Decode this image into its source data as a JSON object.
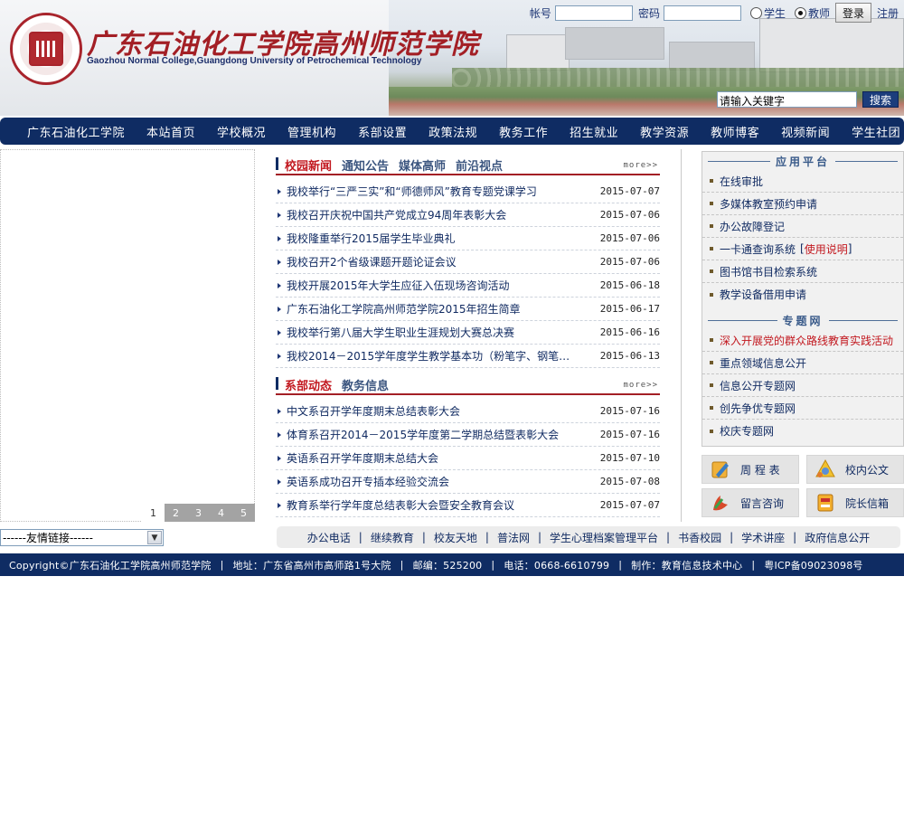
{
  "header": {
    "school_name_cn": "广东石油化工学院高州师范学院",
    "school_name_en": "Gaozhou Normal College,Guangdong University of Petrochemical Technology",
    "login": {
      "account_label": "帐号",
      "password_label": "密码",
      "account_value": "",
      "password_value": "",
      "roles": [
        {
          "label": "学生",
          "selected": false
        },
        {
          "label": "教师",
          "selected": true
        }
      ],
      "login_button": "登录",
      "register_link": "注册"
    },
    "search": {
      "input_value": "请输入关键字",
      "button": "搜索"
    }
  },
  "nav": {
    "items": [
      "广东石油化工学院",
      "本站首页",
      "学校概况",
      "管理机构",
      "系部设置",
      "政策法规",
      "教务工作",
      "招生就业",
      "教学资源",
      "教师博客",
      "视频新闻",
      "学生社团"
    ]
  },
  "slideshow": {
    "pages": [
      "1",
      "2",
      "3",
      "4",
      "5"
    ],
    "active_page": "1"
  },
  "friend_links": {
    "selected": "------友情链接------"
  },
  "news_block": {
    "tabs": [
      "校园新闻",
      "通知公告",
      "媒体高师",
      "前沿视点"
    ],
    "more": "more>>",
    "items": [
      {
        "title": "我校举行“三严三实”和“师德师风”教育专题党课学习",
        "date": "2015-07-07"
      },
      {
        "title": "我校召开庆祝中国共产党成立94周年表彰大会",
        "date": "2015-07-06"
      },
      {
        "title": "我校隆重举行2015届学生毕业典礼",
        "date": "2015-07-06"
      },
      {
        "title": "我校召开2个省级课题开题论证会议",
        "date": "2015-07-06"
      },
      {
        "title": "我校开展2015年大学生应征入伍现场咨询活动",
        "date": "2015-06-18"
      },
      {
        "title": "广东石油化工学院高州师范学院2015年招生简章",
        "date": "2015-06-17"
      },
      {
        "title": "我校举行第八届大学生职业生涯规划大赛总决赛",
        "date": "2015-06-16"
      },
      {
        "title": "我校2014－2015学年度学生教学基本功（粉笔字、钢笔…",
        "date": "2015-06-13"
      }
    ]
  },
  "dept_block": {
    "tabs": [
      "系部动态",
      "教务信息"
    ],
    "more": "more>>",
    "items": [
      {
        "title": "中文系召开学年度期末总结表彰大会",
        "date": "2015-07-16"
      },
      {
        "title": "体育系召开2014－2015学年度第二学期总结暨表彰大会",
        "date": "2015-07-16"
      },
      {
        "title": "英语系召开学年度期末总结大会",
        "date": "2015-07-10"
      },
      {
        "title": "英语系成功召开专插本经验交流会",
        "date": "2015-07-08"
      },
      {
        "title": "教育系举行学年度总结表彰大会暨安全教育会议",
        "date": "2015-07-07"
      }
    ]
  },
  "platform": {
    "title": "应用平台",
    "items": [
      {
        "label": "在线审批"
      },
      {
        "label": "多媒体教室预约申请"
      },
      {
        "label": "办公故障登记"
      },
      {
        "label": "一卡通查询系统",
        "extra_prefix": "[",
        "extra": "使用说明",
        "extra_suffix": "]"
      },
      {
        "label": "图书馆书目检索系统"
      },
      {
        "label": "教学设备借用申请"
      }
    ]
  },
  "topics": {
    "title": "专题网",
    "items": [
      {
        "label": "深入开展党的群众路线教育实践活动",
        "highlight": true
      },
      {
        "label": "重点领域信息公开"
      },
      {
        "label": "信息公开专题网"
      },
      {
        "label": "创先争优专题网"
      },
      {
        "label": "校庆专题网"
      }
    ]
  },
  "quick_links": [
    {
      "label": "周 程 表",
      "icon": "pencil-icon"
    },
    {
      "label": "校内公文",
      "icon": "document-icon"
    },
    {
      "label": "留言咨询",
      "icon": "message-icon"
    },
    {
      "label": "院长信箱",
      "icon": "mailbox-icon"
    }
  ],
  "bottom_links": [
    "办公电话",
    "继续教育",
    "校友天地",
    "普法网",
    "学生心理档案管理平台",
    "书香校园",
    "学术讲座",
    "政府信息公开"
  ],
  "footer": {
    "copyright": "Copyright©广东石油化工学院高州师范学院",
    "address": "地址：广东省高州市高师路1号大院",
    "postcode": "邮编：525200",
    "phone": "电话：0668-6610799",
    "maker": "制作：教育信息技术中心",
    "icp": "粤ICP备09023098号"
  },
  "colors": {
    "nav_bg": "#0f2c63",
    "accent_red": "#c2181f",
    "link_blue": "#112b62"
  }
}
